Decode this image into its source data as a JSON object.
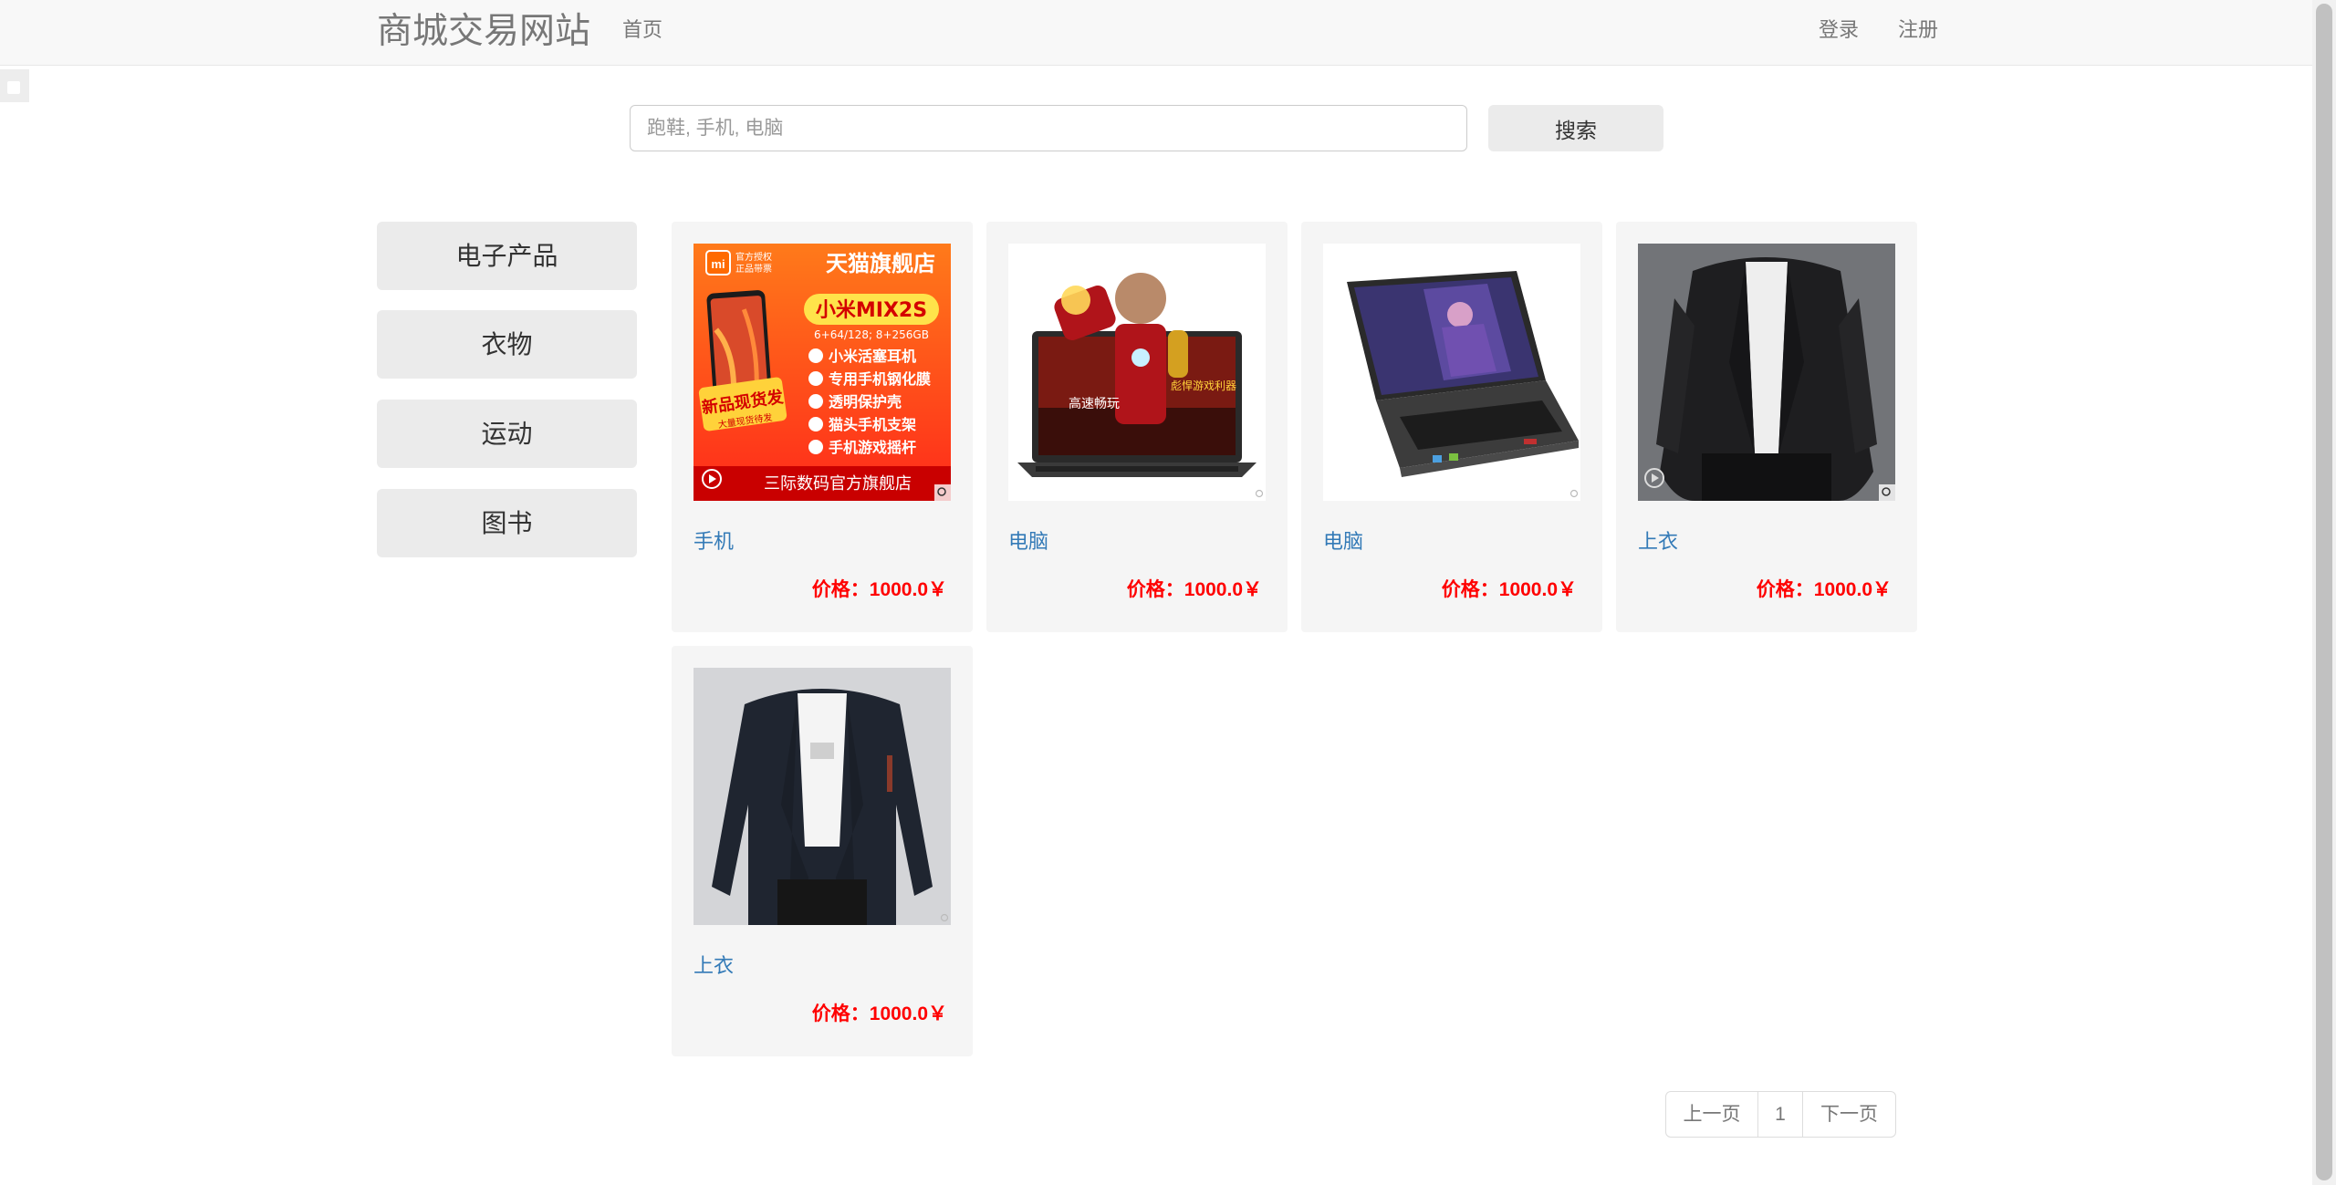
{
  "navbar": {
    "brand": "商城交易网站",
    "home": "首页",
    "login": "登录",
    "register": "注册"
  },
  "search": {
    "placeholder": "跑鞋, 手机, 电脑",
    "button": "搜索"
  },
  "categories": [
    "电子产品",
    "衣物",
    "运动",
    "图书"
  ],
  "products": [
    {
      "name": "手机",
      "price": "价格：1000.0￥",
      "image": {
        "logo": "mi",
        "auth_line1": "官方授权",
        "auth_line2": "正品带票",
        "store": "天猫旗舰店",
        "model": "小米MIX2S",
        "specs": "6+64/128; 8+256GB",
        "perks": [
          "小米活塞耳机",
          "专用手机钢化膜",
          "透明保护壳",
          "猫头手机支架",
          "手机游戏摇杆"
        ],
        "banner": "新品现货发",
        "banner_sub": "大量现货待发",
        "footer": "三际数码官方旗舰店"
      }
    },
    {
      "name": "电脑",
      "price": "价格：1000.0￥",
      "image": {
        "tag1": "高速畅玩",
        "tag2": "彪悍游戏利器"
      }
    },
    {
      "name": "电脑",
      "price": "价格：1000.0￥",
      "image": {}
    },
    {
      "name": "上衣",
      "price": "价格：1000.0￥",
      "image": {}
    },
    {
      "name": "上衣",
      "price": "价格：1000.0￥",
      "image": {}
    }
  ],
  "pagination": {
    "prev": "上一页",
    "page": "1",
    "next": "下一页"
  },
  "colors": {
    "price": "#ff0000",
    "link": "#337ab7",
    "brand": "#777777"
  }
}
